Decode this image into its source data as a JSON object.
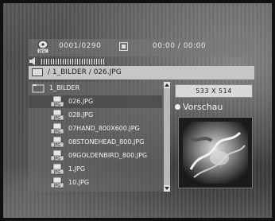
{
  "player": {
    "counter": "0001/0290",
    "time": "00:00 / 00:00",
    "disc_icon": "disc-icon",
    "disc_icon_label": "DISC",
    "stop_icon": "stop-icon",
    "volume_icon": "speaker-icon"
  },
  "path": {
    "text": "/ 1_BILDER / 026.JPG",
    "icon": "folder-icon"
  },
  "file_list": {
    "parent": {
      "label": "1_BILDER",
      "icon": "folder-open-icon"
    },
    "items": [
      {
        "label": "026.JPG",
        "icon": "jpg-file-icon",
        "selected": true
      },
      {
        "label": "028.JPG",
        "icon": "jpg-file-icon",
        "selected": false
      },
      {
        "label": "07HAND_800X600.JPG",
        "icon": "jpg-file-icon",
        "selected": false
      },
      {
        "label": "08STONEHEAD_800.JPG",
        "icon": "jpg-file-icon",
        "selected": false
      },
      {
        "label": "09GOLDENBIRD_800.JPG",
        "icon": "jpg-file-icon",
        "selected": false
      },
      {
        "label": "1.JPG",
        "icon": "jpg-file-icon",
        "selected": false
      },
      {
        "label": "10.JPG",
        "icon": "jpg-file-icon",
        "selected": false
      }
    ],
    "jpg_icon_label": "JPG"
  },
  "preview": {
    "resolution": "533  X  514",
    "label": "Vorschau"
  }
}
